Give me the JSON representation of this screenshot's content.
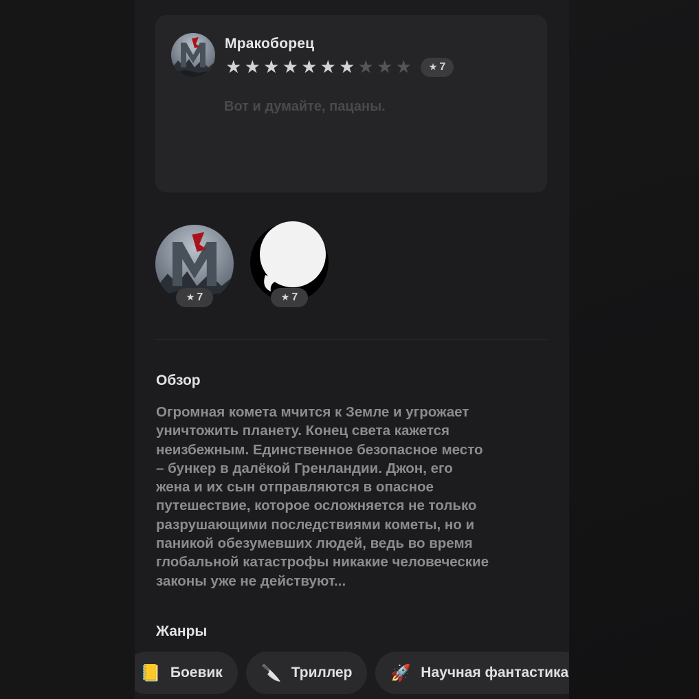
{
  "review": {
    "author": "Мракоборец",
    "rating_out_of_10": 7,
    "rating_badge": "7",
    "text": "Вот и думайте, пацаны."
  },
  "friends": [
    {
      "avatar_icon": "monster-m-avatar",
      "rating": "7"
    },
    {
      "avatar_icon": "chat-bubble-avatar",
      "rating": "7"
    }
  ],
  "overview": {
    "title": "Обзор",
    "text": "Огромная комета мчится к Земле и угрожает\nуничтожить планету. Конец света кажется\nнеизбежным. Единственное безопасное место\n– бункер в далёкой Гренландии. Джон, его\nжена и их сын отправляются в опасное\nпутешествие, которое осложняется не только\nразрушающими последствиями кометы, но и\nпаникой обезумевших людей, ведь во время\nглобальной катастрофы никакие человеческие\nзаконы уже не действуют..."
  },
  "genres": {
    "title": "Жанры",
    "items": [
      {
        "emoji": "📒",
        "label": "Боевик"
      },
      {
        "emoji": "🔪",
        "label": "Триллер"
      },
      {
        "emoji": "🚀",
        "label": "Научная фантастика"
      }
    ]
  },
  "colors": {
    "background": "#161617",
    "panel": "#1c1c1e",
    "card": "#252527",
    "pill": "#3b3b3d",
    "star_on": "#d4d4d4",
    "star_off": "#555557"
  }
}
